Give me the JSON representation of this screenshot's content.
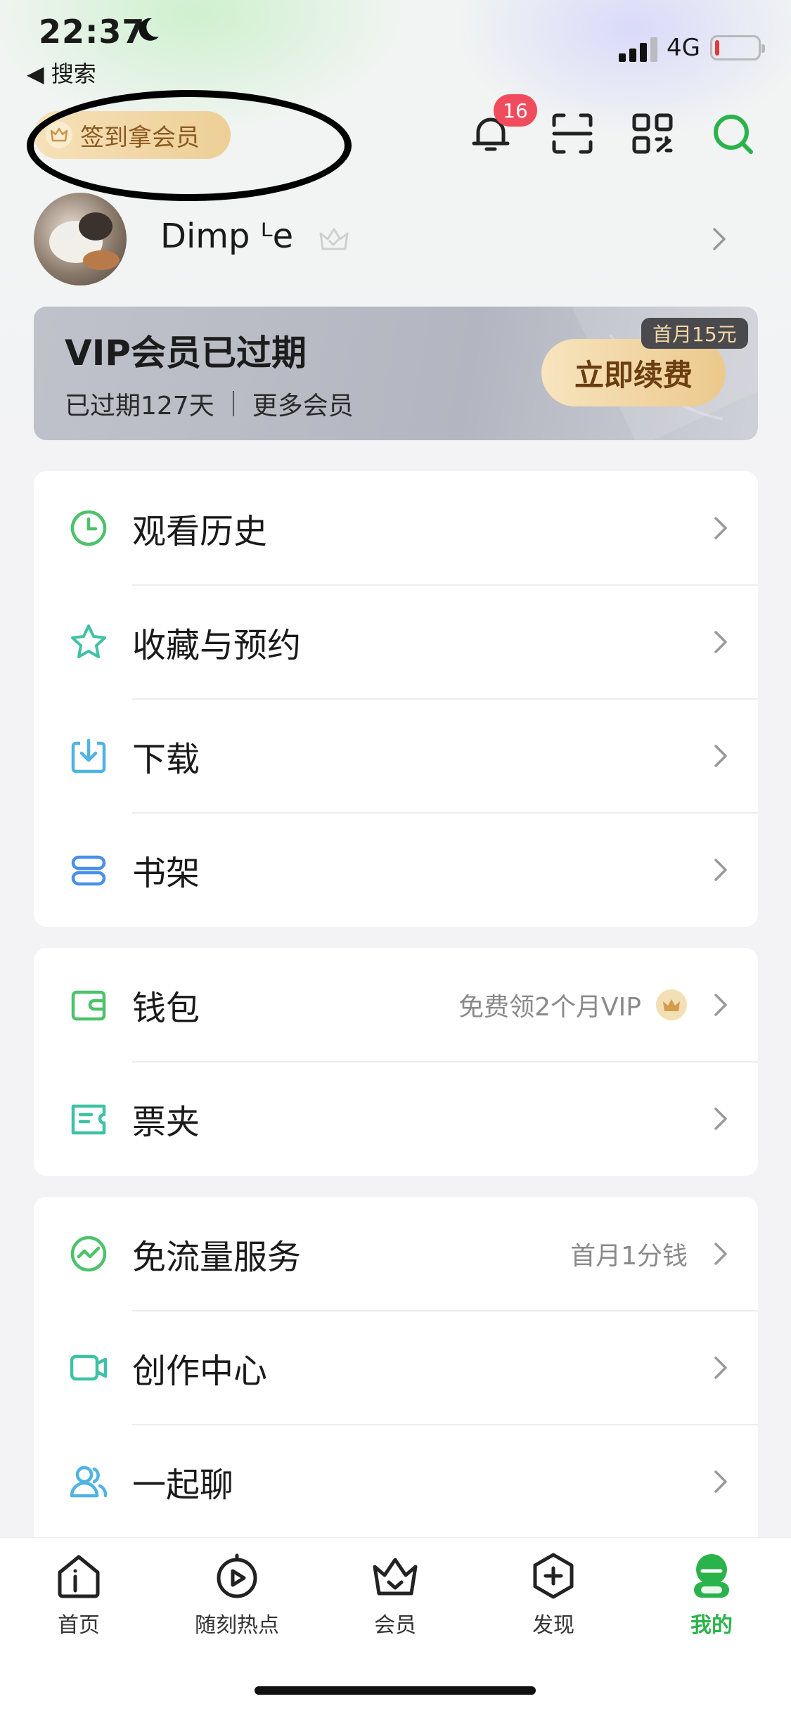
{
  "status_bar": {
    "time": "22:37",
    "back_label": "◀ 搜索",
    "network": "4G",
    "battery_percent": 10
  },
  "top_bar": {
    "signin_label": "签到拿会员",
    "notification_count": "16"
  },
  "profile": {
    "username": "Dimp ᴸe"
  },
  "vip_card": {
    "title": "VIP会员已过期",
    "expired_text": "已过期127天",
    "more_text": "更多会员",
    "promo_tag": "首月15元",
    "renew_button": "立即续费"
  },
  "menu_group_1": [
    {
      "label": "观看历史",
      "icon": "clock-icon"
    },
    {
      "label": "收藏与预约",
      "icon": "star-icon"
    },
    {
      "label": "下载",
      "icon": "download-icon"
    },
    {
      "label": "书架",
      "icon": "bookshelf-icon"
    }
  ],
  "menu_group_2": [
    {
      "label": "钱包",
      "icon": "wallet-icon",
      "right_text": "免费领2个月VIP"
    },
    {
      "label": "票夹",
      "icon": "ticket-icon"
    }
  ],
  "menu_group_3": [
    {
      "label": "免流量服务",
      "icon": "data-free-icon",
      "right_text": "首月1分钱"
    },
    {
      "label": "创作中心",
      "icon": "video-camera-icon"
    },
    {
      "label": "一起聊",
      "icon": "people-icon"
    }
  ],
  "tab_bar": [
    {
      "label": "首页",
      "icon": "home-icon"
    },
    {
      "label": "随刻热点",
      "icon": "play-hot-icon"
    },
    {
      "label": "会员",
      "icon": "crown-icon"
    },
    {
      "label": "发现",
      "icon": "discover-icon"
    },
    {
      "label": "我的",
      "icon": "profile-icon",
      "active": true
    }
  ],
  "colors": {
    "accent_green": "#2bb34b",
    "badge_red": "#f04c5d",
    "gold": "#ecc98c"
  }
}
